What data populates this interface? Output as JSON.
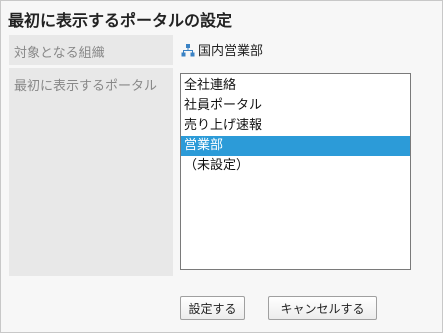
{
  "page": {
    "title": "最初に表示するポータルの設定"
  },
  "form": {
    "org_label": "対象となる組織",
    "org_value": "国内営業部",
    "org_icon": "organization-icon",
    "portal_label": "最初に表示するポータル",
    "portal_options": [
      {
        "label": "全社連絡",
        "selected": false
      },
      {
        "label": "社員ポータル",
        "selected": false
      },
      {
        "label": "売り上げ速報",
        "selected": false
      },
      {
        "label": "営業部",
        "selected": true
      },
      {
        "label": "（未設定）",
        "selected": false
      }
    ]
  },
  "actions": {
    "save_label": "設定する",
    "cancel_label": "キャンセルする"
  },
  "colors": {
    "selected_bg": "#2c9bd8",
    "icon_blue": "#3a82c4"
  }
}
